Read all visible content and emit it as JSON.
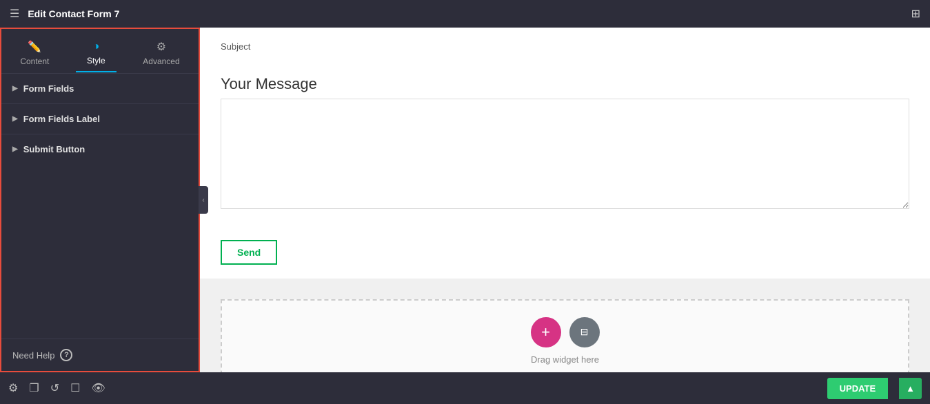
{
  "header": {
    "title": "Edit Contact Form 7",
    "hamburger_label": "☰",
    "grid_label": "⊞"
  },
  "sidebar": {
    "tabs": [
      {
        "id": "content",
        "label": "Content",
        "icon": "✏️",
        "active": false
      },
      {
        "id": "style",
        "label": "Style",
        "icon": "◑",
        "active": true
      },
      {
        "id": "advanced",
        "label": "Advanced",
        "icon": "⚙",
        "active": false
      }
    ],
    "sections": [
      {
        "id": "form-fields",
        "label": "Form Fields"
      },
      {
        "id": "form-fields-label",
        "label": "Form Fields Label"
      },
      {
        "id": "submit-button",
        "label": "Submit Button"
      }
    ],
    "need_help_label": "Need Help",
    "collapse_icon": "‹"
  },
  "canvas": {
    "subject_text": "Subject",
    "message_placeholder": "Your Message",
    "send_button_label": "Send",
    "drag_widget_label": "Drag widget here",
    "add_icon": "+",
    "layout_icon": "⊟"
  },
  "toolbar": {
    "update_label": "UPDATE",
    "dropdown_icon": "▲",
    "icons": [
      "⚙",
      "❐",
      "↺",
      "☐",
      "👁"
    ]
  }
}
